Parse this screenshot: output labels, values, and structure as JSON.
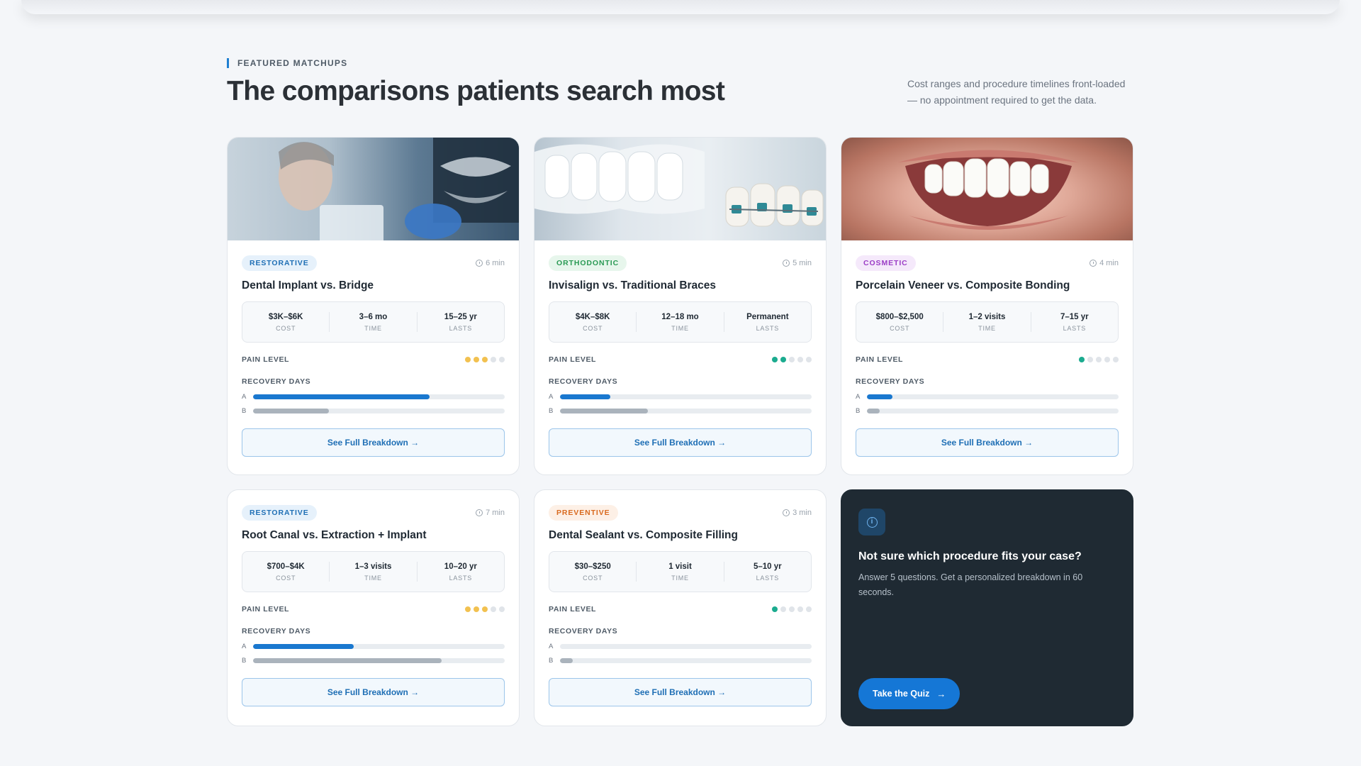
{
  "section": {
    "eyebrow": "FEATURED MATCHUPS",
    "title": "The comparisons patients search most",
    "subtitle": "Cost ranges and procedure timelines front-loaded — no appointment required to get the data."
  },
  "cards": [
    {
      "category": "RESTORATIVE",
      "category_color": "#1f6fb5",
      "read_time": "6 min",
      "title": "Dental Implant vs. Bridge",
      "stats": [
        {
          "value": "$3K–$6K",
          "label": "COST"
        },
        {
          "value": "3–6 mo",
          "label": "TIME"
        },
        {
          "value": "15–25 yr",
          "label": "LASTS"
        }
      ],
      "pain_label": "PAIN LEVEL",
      "pain_level": 3,
      "pain_max": 5,
      "recovery_label": "RECOVERY DAYS",
      "recovery": {
        "a_label": "A",
        "a_fraction": 0.7,
        "b_label": "B",
        "b_fraction": 0.3
      },
      "button": "See Full Breakdown →"
    },
    {
      "category": "ORTHODONTIC",
      "category_color": "#2a9a54",
      "read_time": "5 min",
      "title": "Invisalign vs. Traditional Braces",
      "stats": [
        {
          "value": "$4K–$8K",
          "label": "COST"
        },
        {
          "value": "12–18 mo",
          "label": "TIME"
        },
        {
          "value": "Permanent",
          "label": "LASTS"
        }
      ],
      "pain_label": "PAIN LEVEL",
      "pain_level": 2,
      "pain_max": 5,
      "recovery_label": "RECOVERY DAYS",
      "recovery": {
        "a_label": "A",
        "a_fraction": 0.2,
        "b_label": "B",
        "b_fraction": 0.35
      },
      "button": "See Full Breakdown →"
    },
    {
      "category": "COSMETIC",
      "category_color": "#9b3dc6",
      "read_time": "4 min",
      "title": "Porcelain Veneer vs. Composite Bonding",
      "stats": [
        {
          "value": "$800–$2,500",
          "label": "COST"
        },
        {
          "value": "1–2 visits",
          "label": "TIME"
        },
        {
          "value": "7–15 yr",
          "label": "LASTS"
        }
      ],
      "pain_label": "PAIN LEVEL",
      "pain_level": 1,
      "pain_max": 5,
      "recovery_label": "RECOVERY DAYS",
      "recovery": {
        "a_label": "A",
        "a_fraction": 0.1,
        "b_label": "B",
        "b_fraction": 0.05
      },
      "button": "See Full Breakdown →"
    },
    {
      "category": "RESTORATIVE",
      "category_color": "#1f6fb5",
      "read_time": "7 min",
      "title": "Root Canal vs. Extraction + Implant",
      "stats": [
        {
          "value": "$700–$4K",
          "label": "COST"
        },
        {
          "value": "1–3 visits",
          "label": "TIME"
        },
        {
          "value": "10–20 yr",
          "label": "LASTS"
        }
      ],
      "pain_label": "PAIN LEVEL",
      "pain_level": 3,
      "pain_max": 5,
      "recovery_label": "RECOVERY DAYS",
      "recovery": {
        "a_label": "A",
        "a_fraction": 0.4,
        "b_label": "B",
        "b_fraction": 0.75
      },
      "button": "See Full Breakdown →"
    },
    {
      "category": "PREVENTIVE",
      "category_color": "#d96a1f",
      "read_time": "3 min",
      "title": "Dental Sealant vs. Composite Filling",
      "stats": [
        {
          "value": "$30–$250",
          "label": "COST"
        },
        {
          "value": "1 visit",
          "label": "TIME"
        },
        {
          "value": "5–10 yr",
          "label": "LASTS"
        }
      ],
      "pain_label": "PAIN LEVEL",
      "pain_level": 1,
      "pain_max": 5,
      "recovery_label": "RECOVERY DAYS",
      "recovery": {
        "a_label": "A",
        "a_fraction": 0.0,
        "b_label": "B",
        "b_fraction": 0.05
      },
      "button": "See Full Breakdown →"
    }
  ],
  "cta": {
    "icon": "info-circle-icon",
    "title": "Not sure which procedure fits your case?",
    "text": "Answer 5 questions. Get a personalized breakdown in 60 seconds.",
    "button": "Take the Quiz",
    "button_icon": "arrow-right-icon",
    "bg_color": "#1f2a33",
    "accent_color": "#1577d6"
  }
}
